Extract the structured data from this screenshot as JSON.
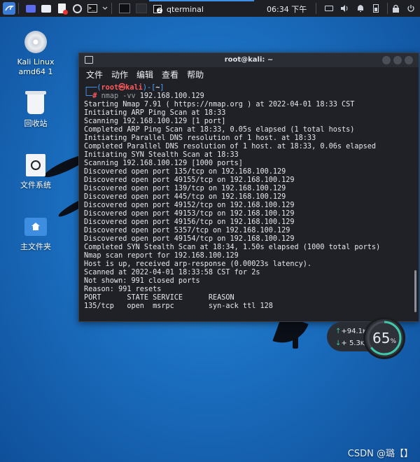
{
  "panel": {
    "task_title": "qterminal",
    "task_badge": "2",
    "clock": "06:34 下午"
  },
  "desktop_icons": [
    {
      "label": "Kali Linux\namd64 1"
    },
    {
      "label": "回收站"
    },
    {
      "label": "文件系统"
    },
    {
      "label": "主文件夹"
    }
  ],
  "terminal": {
    "title": "root@kali: ~",
    "menu": [
      "文件",
      "动作",
      "编辑",
      "查看",
      "帮助"
    ],
    "prompt_line1_pre": "┌──(",
    "prompt_user": "root㉿kali",
    "prompt_line1_post": ")-[",
    "prompt_dir": "~",
    "prompt_line1_end": "]",
    "prompt_line2_pre": "└─",
    "prompt_hash": "# ",
    "prompt_cmd": "nmap -vv",
    "prompt_arg": " 192.168.100.129",
    "output": [
      "Starting Nmap 7.91 ( https://nmap.org ) at 2022-04-01 18:33 CST",
      "Initiating ARP Ping Scan at 18:33",
      "Scanning 192.168.100.129 [1 port]",
      "Completed ARP Ping Scan at 18:33, 0.05s elapsed (1 total hosts)",
      "Initiating Parallel DNS resolution of 1 host. at 18:33",
      "Completed Parallel DNS resolution of 1 host. at 18:33, 0.06s elapsed",
      "Initiating SYN Stealth Scan at 18:33",
      "Scanning 192.168.100.129 [1000 ports]",
      "Discovered open port 135/tcp on 192.168.100.129",
      "Discovered open port 49155/tcp on 192.168.100.129",
      "Discovered open port 139/tcp on 192.168.100.129",
      "Discovered open port 445/tcp on 192.168.100.129",
      "Discovered open port 49152/tcp on 192.168.100.129",
      "Discovered open port 49153/tcp on 192.168.100.129",
      "Discovered open port 49156/tcp on 192.168.100.129",
      "Discovered open port 5357/tcp on 192.168.100.129",
      "Discovered open port 49154/tcp on 192.168.100.129",
      "Completed SYN Stealth Scan at 18:34, 1.50s elapsed (1000 total ports)",
      "Nmap scan report for 192.168.100.129",
      "Host is up, received arp-response (0.00023s latency).",
      "Scanned at 2022-04-01 18:33:58 CST for 2s",
      "Not shown: 991 closed ports",
      "Reason: 991 resets",
      "PORT      STATE SERVICE      REASON",
      "135/tcp   open  msrpc        syn-ack ttl 128"
    ]
  },
  "netmon": {
    "up": "+94.1",
    "up_unit": "K/s",
    "down": "+ 5.3",
    "down_unit": "K/s",
    "percent": "65",
    "percent_unit": "%",
    "percent_value": 0.65
  },
  "watermark": "CSDN @璐【】",
  "colors": {
    "prompt_user": "#ff5b5b",
    "prompt_bracket": "#4aa3ff",
    "gauge_ring": "#3fc7a9"
  }
}
